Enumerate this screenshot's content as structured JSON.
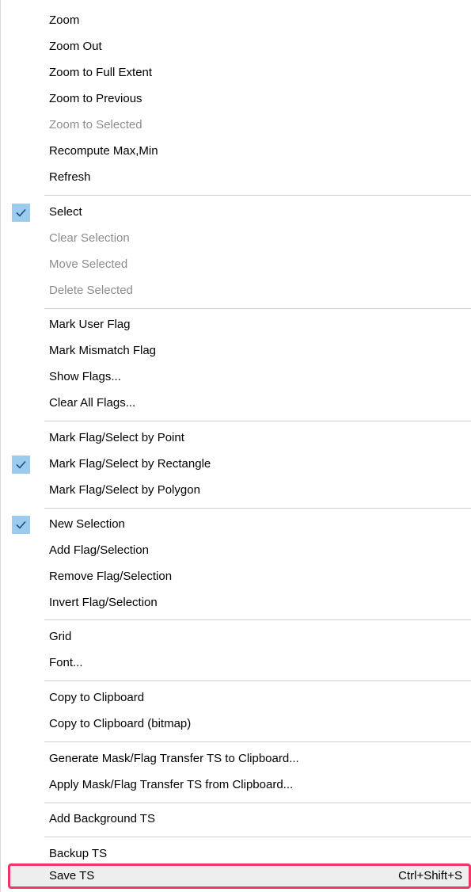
{
  "menu": {
    "items": [
      {
        "label": "Zoom"
      },
      {
        "label": "Zoom Out"
      },
      {
        "label": "Zoom to Full Extent"
      },
      {
        "label": "Zoom to Previous"
      },
      {
        "label": "Zoom to Selected",
        "disabled": true
      },
      {
        "label": "Recompute Max,Min"
      },
      {
        "label": "Refresh"
      },
      {
        "label": "Select",
        "checked": true
      },
      {
        "label": "Clear Selection",
        "disabled": true
      },
      {
        "label": "Move Selected",
        "disabled": true
      },
      {
        "label": "Delete Selected",
        "disabled": true
      },
      {
        "label": "Mark User Flag"
      },
      {
        "label": "Mark Mismatch Flag"
      },
      {
        "label": "Show Flags..."
      },
      {
        "label": "Clear All Flags..."
      },
      {
        "label": "Mark Flag/Select by Point"
      },
      {
        "label": "Mark Flag/Select by Rectangle",
        "checked": true
      },
      {
        "label": "Mark Flag/Select by Polygon"
      },
      {
        "label": "New Selection",
        "checked": true
      },
      {
        "label": "Add Flag/Selection"
      },
      {
        "label": "Remove Flag/Selection"
      },
      {
        "label": "Invert Flag/Selection"
      },
      {
        "label": "Grid"
      },
      {
        "label": "Font..."
      },
      {
        "label": "Copy to Clipboard"
      },
      {
        "label": "Copy to Clipboard (bitmap)"
      },
      {
        "label": "Generate Mask/Flag Transfer TS to Clipboard..."
      },
      {
        "label": "Apply Mask/Flag Transfer TS from Clipboard..."
      },
      {
        "label": "Add Background TS"
      },
      {
        "label": "Backup TS"
      },
      {
        "label": "Save TS",
        "shortcut": "Ctrl+Shift+S",
        "highlighted": true
      }
    ]
  },
  "colors": {
    "check_background": "#9ccbf0",
    "check_mark": "#1e4f82",
    "disabled_text": "#8c8c8c",
    "highlight_border": "#ef3466",
    "highlight_background": "#eeeeee",
    "separator": "#d0d0d0"
  }
}
